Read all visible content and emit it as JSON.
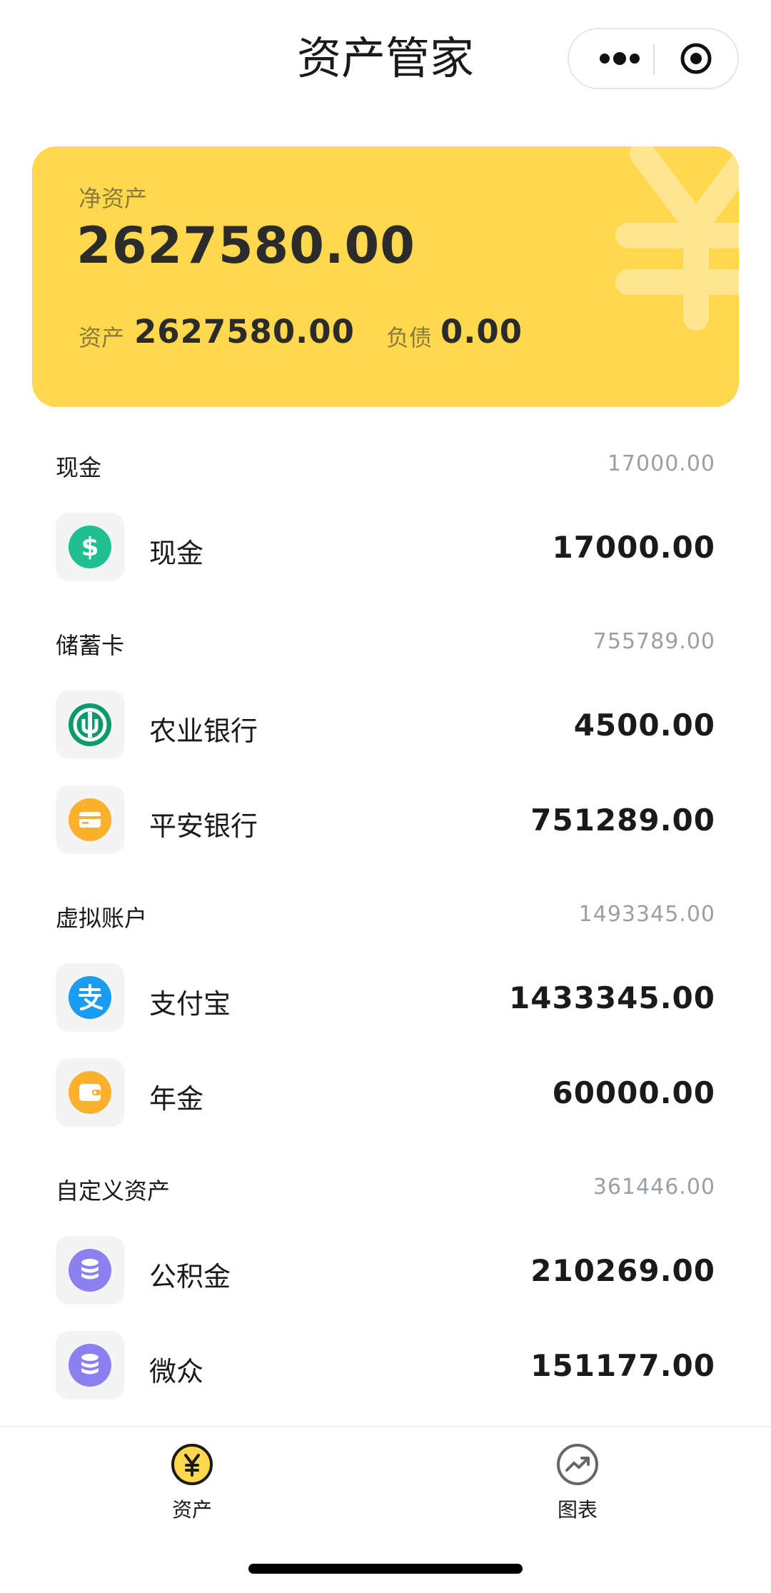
{
  "header": {
    "title": "资产管家"
  },
  "summary": {
    "net_label": "净资产",
    "net_value": "2627580.00",
    "assets_label": "资产",
    "assets_value": "2627580.00",
    "liabilities_label": "负债",
    "liabilities_value": "0.00"
  },
  "sections": [
    {
      "title": "现金",
      "total": "17000.00",
      "items": [
        {
          "name": "现金",
          "amount": "17000.00",
          "icon": "dollar-icon",
          "color": "#1fbf8f"
        }
      ]
    },
    {
      "title": "储蓄卡",
      "total": "755789.00",
      "items": [
        {
          "name": "农业银行",
          "amount": "4500.00",
          "icon": "abc-bank-icon",
          "color": "#0b9a6a"
        },
        {
          "name": "平安银行",
          "amount": "751289.00",
          "icon": "card-icon",
          "color": "#fbb12e"
        }
      ]
    },
    {
      "title": "虚拟账户",
      "total": "1493345.00",
      "items": [
        {
          "name": "支付宝",
          "amount": "1433345.00",
          "icon": "alipay-icon",
          "color": "#1a9cf0"
        },
        {
          "name": "年金",
          "amount": "60000.00",
          "icon": "wallet-icon",
          "color": "#fbb12e"
        }
      ]
    },
    {
      "title": "自定义资产",
      "total": "361446.00",
      "items": [
        {
          "name": "公积金",
          "amount": "210269.00",
          "icon": "coins-icon",
          "color": "#8a80f2"
        },
        {
          "name": "微众",
          "amount": "151177.00",
          "icon": "coins-icon",
          "color": "#8a80f2"
        }
      ]
    }
  ],
  "tabbar": {
    "tabs": [
      {
        "label": "资产",
        "icon": "yen-icon",
        "active": true
      },
      {
        "label": "图表",
        "icon": "trend-icon",
        "active": false
      }
    ]
  },
  "colors": {
    "card": "#ffd84d",
    "accent": "#ffd84d"
  }
}
